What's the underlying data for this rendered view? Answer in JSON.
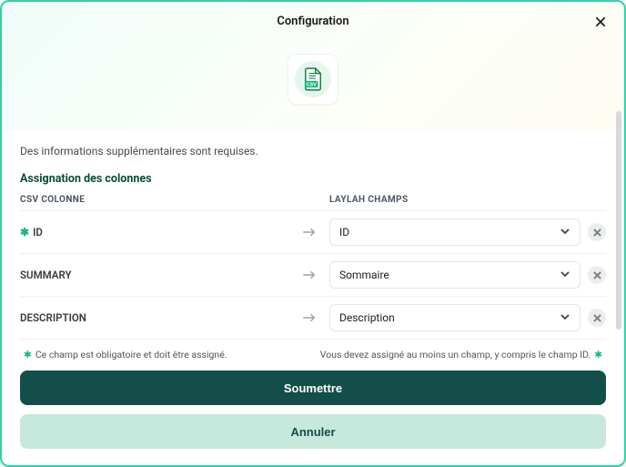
{
  "modal": {
    "title": "Configuration",
    "subtext": "Des informations supplémentaires sont requises.",
    "section_title": "Assignation des colonnes",
    "headers": {
      "csv": "CSV COLONNE",
      "field": "LAYLAH CHAMPS"
    },
    "rows": [
      {
        "csv": "ID",
        "required": true,
        "field": "ID"
      },
      {
        "csv": "SUMMARY",
        "required": false,
        "field": "Sommaire"
      },
      {
        "csv": "DESCRIPTION",
        "required": false,
        "field": "Description"
      }
    ],
    "hints": {
      "left": "Ce champ est obligatoire et doit être assigné.",
      "right": "Vous devez assigné au moins un champ, y compris le champ ID."
    },
    "buttons": {
      "submit": "Soumettre",
      "cancel": "Annuler"
    }
  }
}
